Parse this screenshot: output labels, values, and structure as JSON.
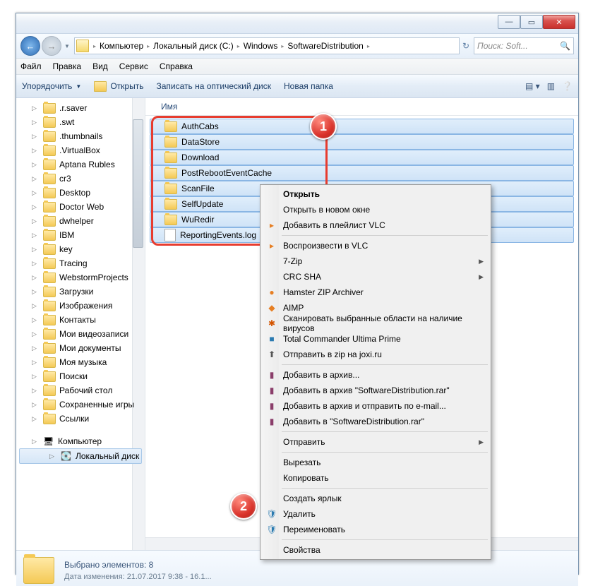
{
  "titlebar": {
    "min": "—",
    "max": "▭",
    "close": "✕"
  },
  "nav": {
    "back": "←",
    "fwd": "→",
    "crumbs": [
      "Компьютер",
      "Локальный диск (C:)",
      "Windows",
      "SoftwareDistribution"
    ],
    "search_placeholder": "Поиск: Soft..."
  },
  "menu": [
    "Файл",
    "Правка",
    "Вид",
    "Сервис",
    "Справка"
  ],
  "toolbar": {
    "organize": "Упорядочить",
    "open": "Открыть",
    "burn": "Записать на оптический диск",
    "newfolder": "Новая папка"
  },
  "sidebar": [
    {
      "t": ".r.saver"
    },
    {
      "t": ".swt"
    },
    {
      "t": ".thumbnails"
    },
    {
      "t": ".VirtualBox"
    },
    {
      "t": "Aptana Rubles"
    },
    {
      "t": "cr3"
    },
    {
      "t": "Desktop"
    },
    {
      "t": "Doctor Web"
    },
    {
      "t": "dwhelper"
    },
    {
      "t": "IBM"
    },
    {
      "t": "key"
    },
    {
      "t": "Tracing"
    },
    {
      "t": "WebstormProjects"
    },
    {
      "t": "Загрузки"
    },
    {
      "t": "Изображения"
    },
    {
      "t": "Контакты"
    },
    {
      "t": "Мои видеозаписи"
    },
    {
      "t": "Мои документы"
    },
    {
      "t": "Моя музыка"
    },
    {
      "t": "Поиски"
    },
    {
      "t": "Рабочий стол"
    },
    {
      "t": "Сохраненные игры"
    },
    {
      "t": "Ссылки"
    }
  ],
  "sidebar2": [
    {
      "t": "Компьютер",
      "k": "comp"
    },
    {
      "t": "Локальный диск (C:)",
      "k": "disk",
      "sel": true
    }
  ],
  "colheader": "Имя",
  "files": [
    {
      "n": "AuthCabs",
      "sel": true
    },
    {
      "n": "DataStore",
      "sel": true
    },
    {
      "n": "Download",
      "sel": true
    },
    {
      "n": "PostRebootEventCache",
      "sel": true
    },
    {
      "n": "ScanFile",
      "sel": true
    },
    {
      "n": "SelfUpdate",
      "sel": true
    },
    {
      "n": "WuRedir",
      "sel": true
    },
    {
      "n": "ReportingEvents.log",
      "sel": true,
      "file": true
    }
  ],
  "context": [
    {
      "t": "Открыть",
      "bold": true
    },
    {
      "t": "Открыть в новом окне"
    },
    {
      "t": "Добавить в плейлист VLC",
      "ic": "▸",
      "c": "#e67e22"
    },
    {
      "sep": true
    },
    {
      "t": "Воспроизвести в VLC",
      "ic": "▸",
      "c": "#e67e22"
    },
    {
      "t": "7-Zip",
      "sub": true
    },
    {
      "t": "CRC SHA",
      "sub": true
    },
    {
      "t": "Hamster ZIP Archiver",
      "ic": "●",
      "c": "#e67e22"
    },
    {
      "t": "AIMP",
      "ic": "◆",
      "c": "#e67e22"
    },
    {
      "t": "Сканировать выбранные области на наличие вирусов",
      "ic": "✱",
      "c": "#d35400"
    },
    {
      "t": "Total Commander Ultima Prime",
      "ic": "■",
      "c": "#2a7ab0"
    },
    {
      "t": "Отправить в zip на joxi.ru",
      "ic": "⬆",
      "c": "#555"
    },
    {
      "sep": true
    },
    {
      "t": "Добавить в архив...",
      "ic": "▮",
      "c": "#8a3d6a"
    },
    {
      "t": "Добавить в архив \"SoftwareDistribution.rar\"",
      "ic": "▮",
      "c": "#8a3d6a"
    },
    {
      "t": "Добавить в архив и отправить по e-mail...",
      "ic": "▮",
      "c": "#8a3d6a"
    },
    {
      "t": "Добавить в \"SoftwareDistribution.rar\"",
      "ic": "▮",
      "c": "#8a3d6a"
    },
    {
      "sep": true
    },
    {
      "t": "Отправить",
      "sub": true
    },
    {
      "sep": true
    },
    {
      "t": "Вырезать"
    },
    {
      "t": "Копировать"
    },
    {
      "sep": true
    },
    {
      "t": "Создать ярлык"
    },
    {
      "t": "Удалить",
      "ic": "🛡",
      "c": "#2a7ab0"
    },
    {
      "t": "Переименовать",
      "ic": "🛡",
      "c": "#2a7ab0"
    },
    {
      "sep": true
    },
    {
      "t": "Свойства"
    }
  ],
  "status": {
    "line1": "Выбрано элементов: 8",
    "line2": "Дата изменения: 21.07.2017 9:38 - 16.1..."
  },
  "badges": {
    "one": "1",
    "two": "2"
  }
}
